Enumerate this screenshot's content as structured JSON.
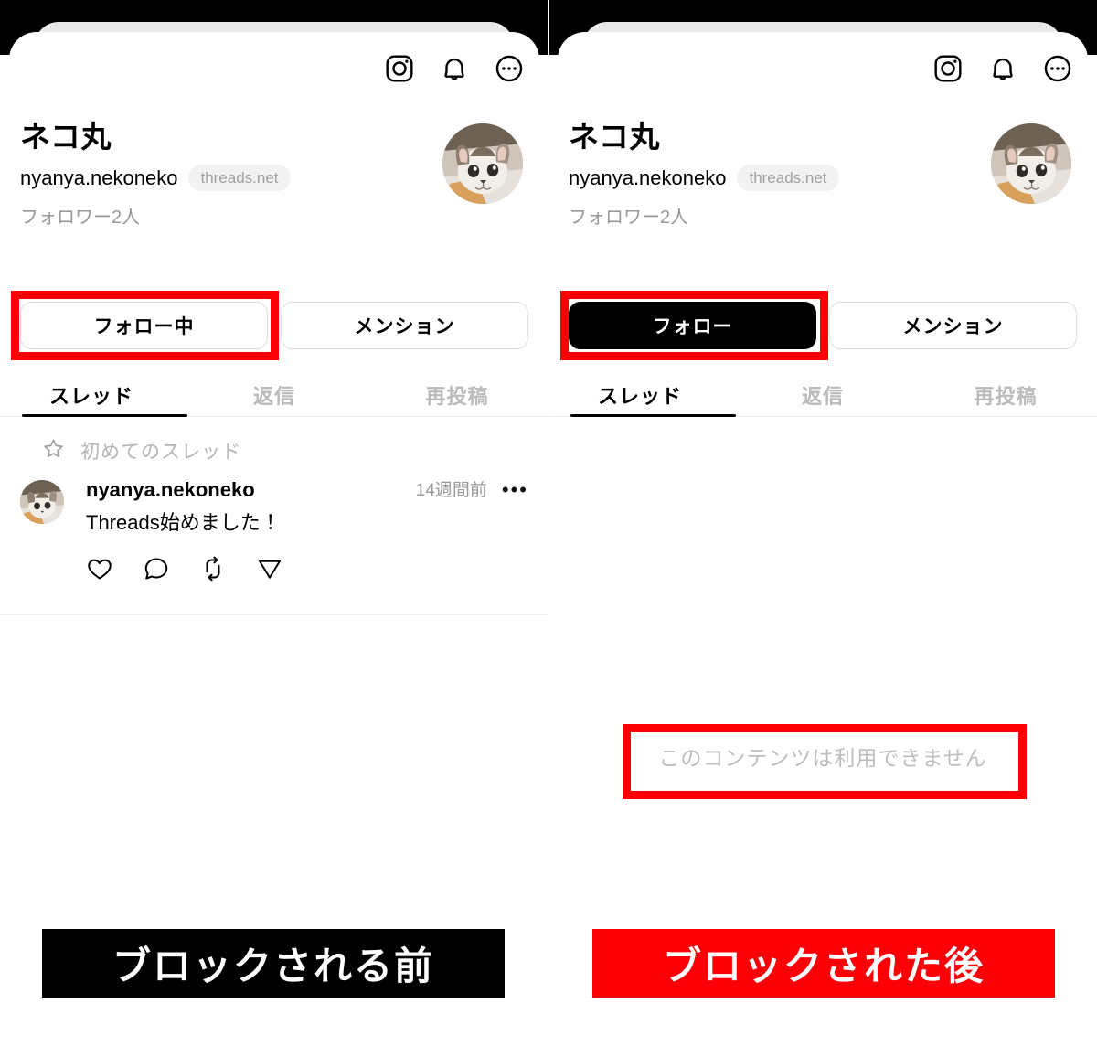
{
  "panels": [
    {
      "id": "before-block",
      "header": {
        "icons": [
          "instagram-icon",
          "bell-icon",
          "more-circle-icon"
        ]
      },
      "profile": {
        "display_name": "ネコ丸",
        "handle": "nyanya.nekoneko",
        "domain_chip": "threads.net",
        "followers": "フォロワー2人",
        "avatar": "kitten-avatar"
      },
      "actions": {
        "primary_label": "フォロー中",
        "primary_filled": false,
        "secondary_label": "メンション"
      },
      "tabs": [
        {
          "label": "スレッド",
          "active": true
        },
        {
          "label": "返信",
          "active": false
        },
        {
          "label": "再投稿",
          "active": false
        }
      ],
      "first_thread": {
        "icon": "star-icon",
        "label": "初めてのスレッド"
      },
      "post": {
        "username": "nyanya.nekoneko",
        "timestamp": "14週間前",
        "more": "•••",
        "text": "Threads始めました！",
        "actions": [
          "heart-icon",
          "comment-icon",
          "repost-icon",
          "share-icon"
        ]
      },
      "unavailable_text": null
    },
    {
      "id": "after-block",
      "header": {
        "icons": [
          "instagram-icon",
          "bell-icon",
          "more-circle-icon"
        ]
      },
      "profile": {
        "display_name": "ネコ丸",
        "handle": "nyanya.nekoneko",
        "domain_chip": "threads.net",
        "followers": "フォロワー2人",
        "avatar": "kitten-avatar"
      },
      "actions": {
        "primary_label": "フォロー",
        "primary_filled": true,
        "secondary_label": "メンション"
      },
      "tabs": [
        {
          "label": "スレッド",
          "active": true
        },
        {
          "label": "返信",
          "active": false
        },
        {
          "label": "再投稿",
          "active": false
        }
      ],
      "first_thread": null,
      "post": null,
      "unavailable_text": "このコンテンツは利用できません"
    }
  ],
  "captions": [
    {
      "id": "before",
      "label": "ブロックされる前",
      "background": "#000000",
      "color": "#ffffff"
    },
    {
      "id": "after",
      "label": "ブロックされた後",
      "background": "#fb0007",
      "color": "#ffffff"
    }
  ],
  "annotations": {
    "color": "#fb0007",
    "boxes": [
      {
        "id": "redbox-follow-left",
        "target": "following-button"
      },
      {
        "id": "redbox-follow-right",
        "target": "follow-button"
      },
      {
        "id": "redbox-unavailable",
        "target": "content-unavailable-text"
      }
    ]
  }
}
